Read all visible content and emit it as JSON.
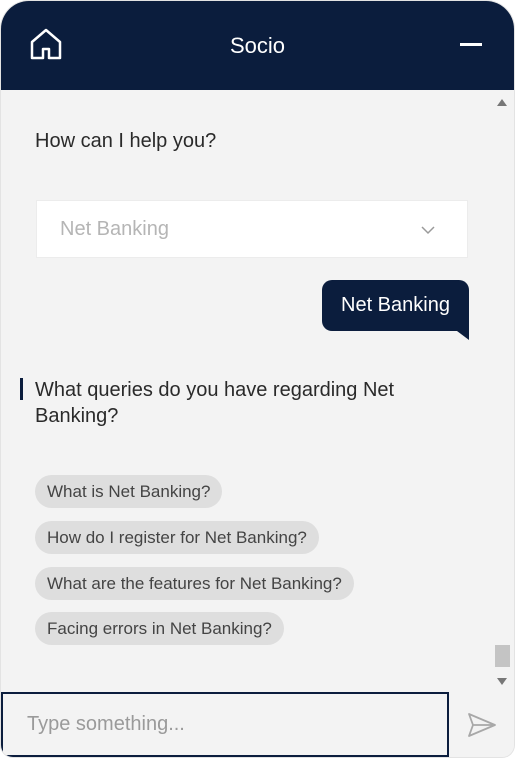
{
  "header": {
    "title": "Socio",
    "home_icon": "home-icon",
    "minimize_icon": "minimize-icon"
  },
  "chat": {
    "greeting": "How can I help you?",
    "select": {
      "value": "Net Banking",
      "icon": "chevron-down-icon"
    },
    "user_message": "Net Banking",
    "bot_question": "What queries do you have regarding Net Banking?",
    "options": [
      "What is Net Banking?",
      "How do I register for Net Banking?",
      "What are the features for Net Banking?",
      "Facing errors in Net Banking?"
    ]
  },
  "input": {
    "placeholder": "Type something...",
    "value": "",
    "send_icon": "send-icon"
  },
  "colors": {
    "brand": "#0b1d3d",
    "background": "#f3f3f3",
    "chip": "#dedede"
  }
}
